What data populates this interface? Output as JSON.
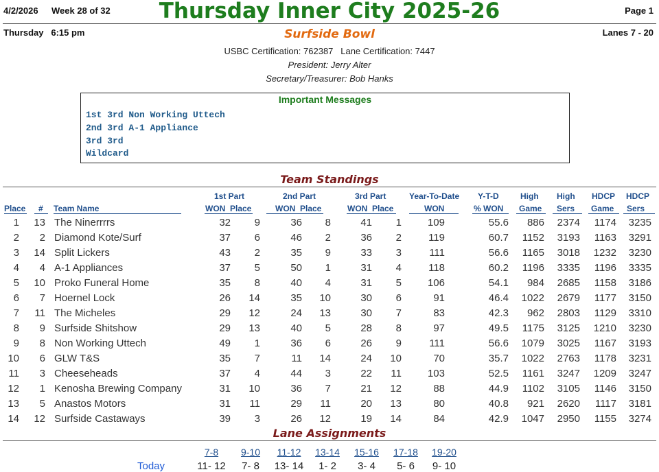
{
  "header": {
    "date": "4/2/2026",
    "week": "Week 28 of 32",
    "title": "Thursday Inner City 2025-26",
    "page": "Page 1",
    "day_time": "Thursday   6:15 pm",
    "bowl": "Surfside Bowl",
    "lanes": "Lanes 7 - 20",
    "certification": "USBC Certification: 762387   Lane Certification: 7447",
    "president": "President: Jerry Alter",
    "secretary": "Secretary/Treasurer: Bob Hanks"
  },
  "messages": {
    "title": "Important Messages",
    "lines": [
      "1st 3rd Non Working Uttech",
      "2nd 3rd A-1 Appliance",
      "3rd 3rd",
      "Wildcard"
    ]
  },
  "standings": {
    "title": "Team Standings",
    "headers": {
      "place": "Place",
      "num": "#",
      "team": "Team Name",
      "p1": "1st Part",
      "p1sub": "WON  Place",
      "p2": "2nd Part",
      "p2sub": "WON  Place",
      "p3": "3rd Part",
      "p3sub": "WON  Place",
      "ytd": "Year-To-Date",
      "ytdsub": "WON",
      "pct": "Y-T-D",
      "pctsub": "% WON",
      "hg": "High",
      "hgsub": "Game",
      "hs": "High",
      "hssub": "Sers",
      "hdg": "HDCP",
      "hdgsub": "Game",
      "hds": "HDCP",
      "hdssub": "Sers"
    },
    "rows": [
      [
        "1",
        "13",
        "The Ninerrrrs",
        "32",
        "9",
        "36",
        "8",
        "41",
        "1",
        "109",
        "55.6",
        "886",
        "2374",
        "1174",
        "3235"
      ],
      [
        "2",
        "2",
        "Diamond Kote/Surf",
        "37",
        "6",
        "46",
        "2",
        "36",
        "2",
        "119",
        "60.7",
        "1152",
        "3193",
        "1163",
        "3291"
      ],
      [
        "3",
        "14",
        "Split Lickers",
        "43",
        "2",
        "35",
        "9",
        "33",
        "3",
        "111",
        "56.6",
        "1165",
        "3018",
        "1232",
        "3230"
      ],
      [
        "4",
        "4",
        "A-1 Appliances",
        "37",
        "5",
        "50",
        "1",
        "31",
        "4",
        "118",
        "60.2",
        "1196",
        "3335",
        "1196",
        "3335"
      ],
      [
        "5",
        "10",
        "Proko Funeral Home",
        "35",
        "8",
        "40",
        "4",
        "31",
        "5",
        "106",
        "54.1",
        "984",
        "2685",
        "1158",
        "3186"
      ],
      [
        "6",
        "7",
        "Hoernel Lock",
        "26",
        "14",
        "35",
        "10",
        "30",
        "6",
        "91",
        "46.4",
        "1022",
        "2679",
        "1177",
        "3150"
      ],
      [
        "7",
        "11",
        "The Micheles",
        "29",
        "12",
        "24",
        "13",
        "30",
        "7",
        "83",
        "42.3",
        "962",
        "2803",
        "1129",
        "3310"
      ],
      [
        "8",
        "9",
        "Surfside Shitshow",
        "29",
        "13",
        "40",
        "5",
        "28",
        "8",
        "97",
        "49.5",
        "1175",
        "3125",
        "1210",
        "3230"
      ],
      [
        "9",
        "8",
        "Non Working Uttech",
        "49",
        "1",
        "36",
        "6",
        "26",
        "9",
        "111",
        "56.6",
        "1079",
        "3025",
        "1167",
        "3193"
      ],
      [
        "10",
        "6",
        "GLW T&S",
        "35",
        "7",
        "11",
        "14",
        "24",
        "10",
        "70",
        "35.7",
        "1022",
        "2763",
        "1178",
        "3231"
      ],
      [
        "11",
        "3",
        "Cheeseheads",
        "37",
        "4",
        "44",
        "3",
        "22",
        "11",
        "103",
        "52.5",
        "1161",
        "3247",
        "1209",
        "3247"
      ],
      [
        "12",
        "1",
        "Kenosha Brewing Company",
        "31",
        "10",
        "36",
        "7",
        "21",
        "12",
        "88",
        "44.9",
        "1102",
        "3105",
        "1146",
        "3150"
      ],
      [
        "13",
        "5",
        "Anastos Motors",
        "31",
        "11",
        "29",
        "11",
        "20",
        "13",
        "80",
        "40.8",
        "921",
        "2620",
        "1117",
        "3181"
      ],
      [
        "14",
        "12",
        "Surfside Castaways",
        "39",
        "3",
        "26",
        "12",
        "19",
        "14",
        "84",
        "42.9",
        "1047",
        "2950",
        "1155",
        "3274"
      ]
    ]
  },
  "lanes": {
    "title": "Lane Assignments",
    "row_label": "Today",
    "pairs": [
      "7-8",
      "9-10",
      "11-12",
      "13-14",
      "15-16",
      "17-18",
      "19-20"
    ],
    "today": [
      "11- 12",
      "7- 8",
      "13- 14",
      "1- 2",
      "3- 4",
      "5- 6",
      "9- 10"
    ]
  }
}
